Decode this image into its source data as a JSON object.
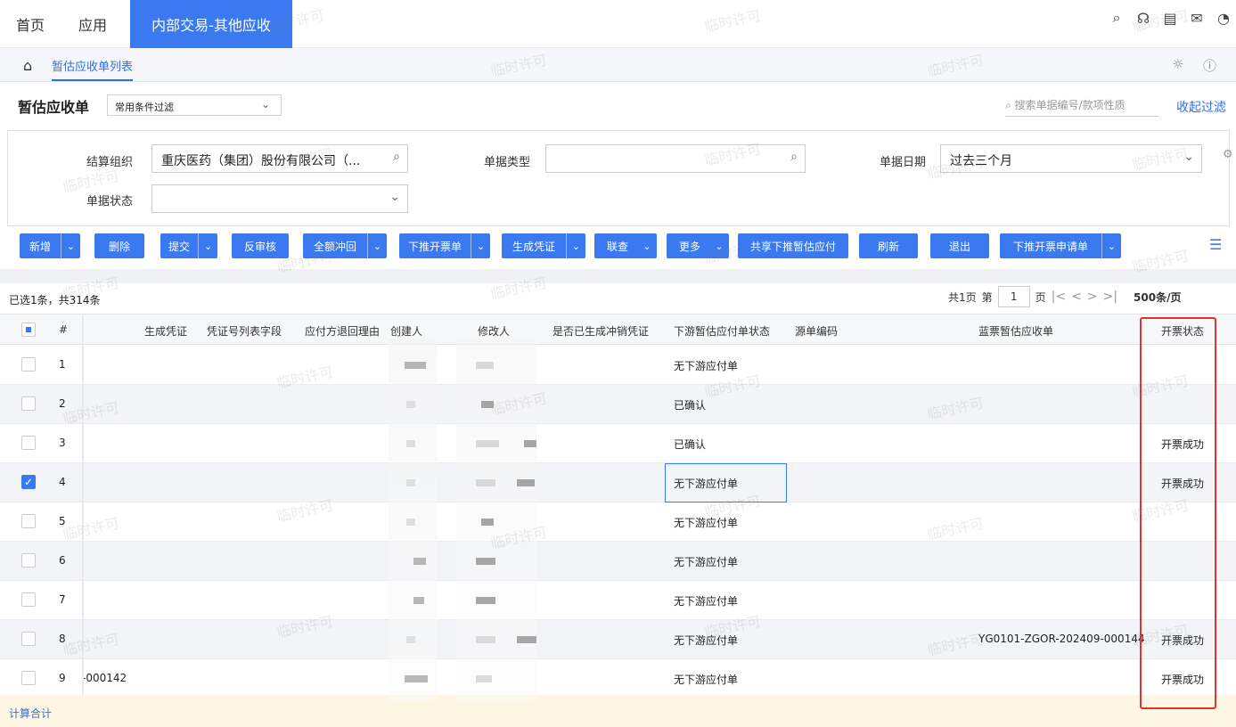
{
  "topbar": {
    "home": "首页",
    "apps": "应用",
    "active_tab": "内部交易-其他应收",
    "icons": [
      "search-icon",
      "headset-icon",
      "document-icon",
      "mail-icon",
      "user-icon"
    ]
  },
  "breadcrumb": {
    "page": "暂估应收单列表"
  },
  "title": {
    "text": "暂估应收单",
    "filter_scheme": "常用条件过滤",
    "search_placeholder": "搜索单据编号/款项性质",
    "collapse": "收起过滤"
  },
  "filters": {
    "org_label": "结算组织",
    "org_value": "重庆医药（集团）股份有限公司（...",
    "doctype_label": "单据类型",
    "doctype_value": "",
    "date_label": "单据日期",
    "date_value": "过去三个月",
    "status_label": "单据状态",
    "status_value": ""
  },
  "toolbar": {
    "add": "新增",
    "delete": "删除",
    "submit": "提交",
    "unaudit": "反审核",
    "full_reverse": "全额冲回",
    "push_invoice": "下推开票单",
    "gen_voucher": "生成凭证",
    "link_query": "联查",
    "more": "更多",
    "share_push": "共享下推暂估应付",
    "refresh": "刷新",
    "exit": "退出",
    "push_invoice_req": "下推开票申请单"
  },
  "status": {
    "selection": "已选1条，共314条",
    "pager_total": "共1页",
    "pager_di": "第",
    "pager_page": "1",
    "pager_ye": "页",
    "page_size": "500条/页"
  },
  "columns": {
    "no": "#",
    "gen_voucher": "生成凭证",
    "voucher_field": "凭证号列表字段",
    "return_reason": "应付方退回理由",
    "creator": "创建人",
    "modifier": "修改人",
    "reverse_voucher": "是否已生成冲销凭证",
    "downstream_status": "下游暂估应付单状态",
    "source_no": "源单编码",
    "blue_bill": "蓝票暂估应收单",
    "invoice_status": "开票状态"
  },
  "rows": [
    {
      "no": "1",
      "first": "",
      "downstream": "无下游应付单",
      "blue": "",
      "invoice": ""
    },
    {
      "no": "2",
      "first": "",
      "downstream": "已确认",
      "blue": "",
      "invoice": ""
    },
    {
      "no": "3",
      "first": "",
      "downstream": "已确认",
      "blue": "",
      "invoice": "开票成功"
    },
    {
      "no": "4",
      "first": "",
      "downstream": "无下游应付单",
      "blue": "",
      "invoice": "开票成功"
    },
    {
      "no": "5",
      "first": "",
      "downstream": "无下游应付单",
      "blue": "",
      "invoice": ""
    },
    {
      "no": "6",
      "first": "",
      "downstream": "无下游应付单",
      "blue": "",
      "invoice": ""
    },
    {
      "no": "7",
      "first": "",
      "downstream": "无下游应付单",
      "blue": "",
      "invoice": ""
    },
    {
      "no": "8",
      "first": "",
      "downstream": "无下游应付单",
      "blue": "YG0101-ZGOR-202409-000144",
      "invoice": "开票成功"
    },
    {
      "no": "9",
      "first": "-000142",
      "downstream": "无下游应付单",
      "blue": "",
      "invoice": "开票成功"
    }
  ],
  "summary": "计算合计",
  "watermark": "临时许可",
  "colors": {
    "primary": "#3a79ef",
    "highlight": "#e5322d"
  }
}
